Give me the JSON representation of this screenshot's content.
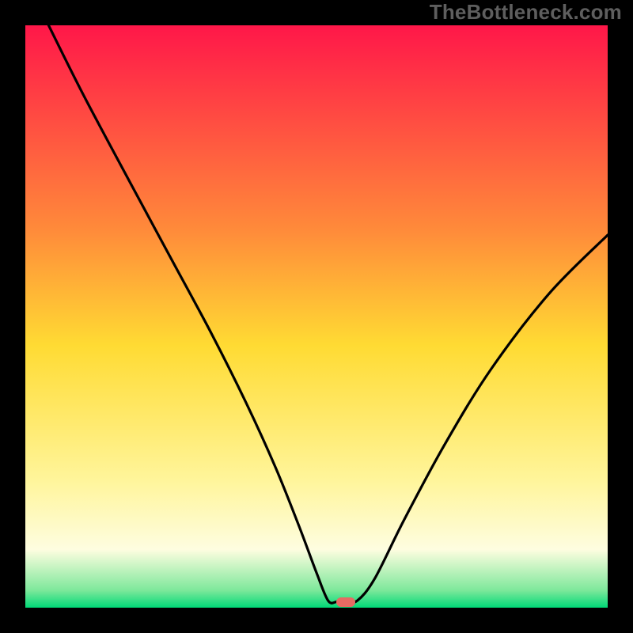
{
  "watermark": "TheBottleneck.com",
  "chart_data": {
    "type": "line",
    "title": "",
    "xlabel": "",
    "ylabel": "",
    "xlim": [
      0,
      100
    ],
    "ylim": [
      0,
      100
    ],
    "grid": false,
    "series": [
      {
        "name": "curve",
        "x": [
          4,
          10,
          18,
          25,
          32,
          38,
          43,
          47,
          50,
          52,
          53.5,
          55,
          57,
          60,
          65,
          72,
          80,
          90,
          100
        ],
        "y": [
          100,
          88,
          73,
          60,
          47,
          35,
          24,
          14,
          6,
          1.2,
          1,
          1,
          1.2,
          5,
          15,
          28,
          41,
          54,
          64
        ]
      }
    ],
    "marker": {
      "x": 55,
      "y": 1,
      "color": "#e66a63"
    },
    "gradient_stops": [
      {
        "pct": 0,
        "color": "#ff1749"
      },
      {
        "pct": 35,
        "color": "#ff8a3a"
      },
      {
        "pct": 55,
        "color": "#ffdb33"
      },
      {
        "pct": 78,
        "color": "#fff59a"
      },
      {
        "pct": 90,
        "color": "#fefde0"
      },
      {
        "pct": 97,
        "color": "#7ee89b"
      },
      {
        "pct": 100,
        "color": "#00d977"
      }
    ]
  }
}
